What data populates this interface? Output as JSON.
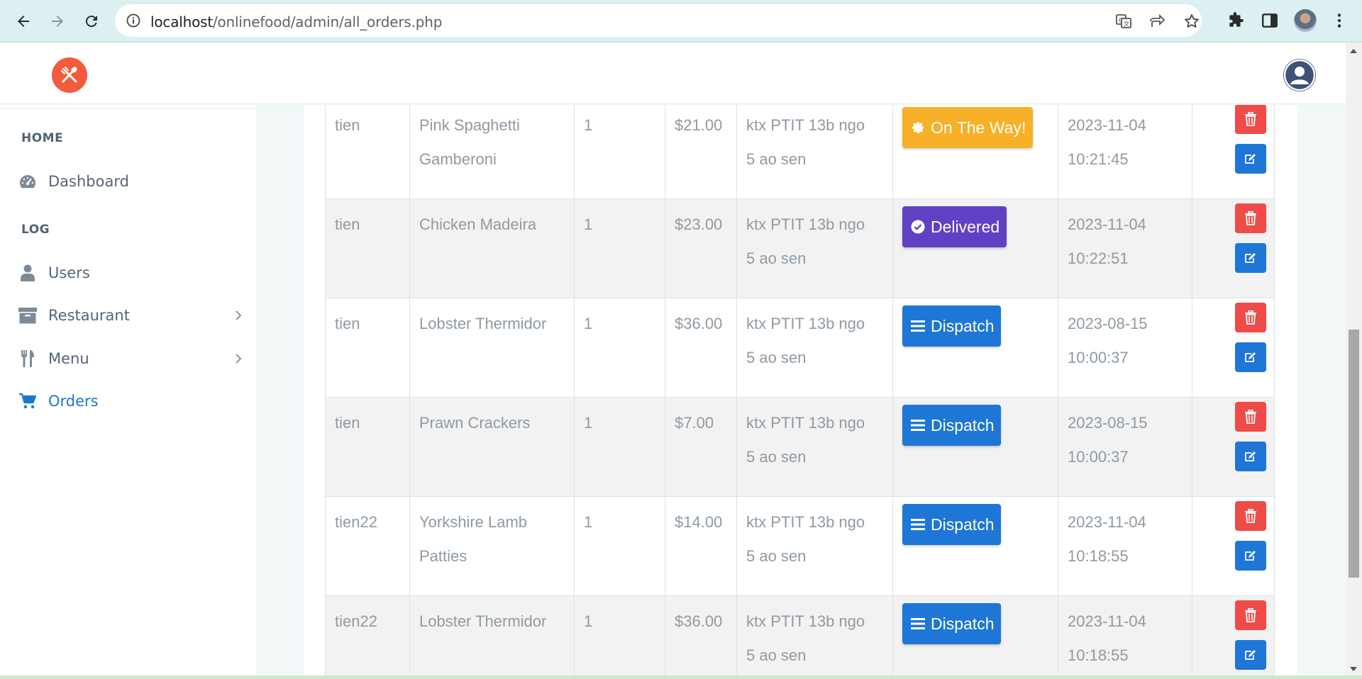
{
  "browser": {
    "url_host": "localhost",
    "url_path": "/onlinefood/admin/all_orders.php"
  },
  "sidebar": {
    "home_caption": "HOME",
    "log_caption": "LOG",
    "items": [
      {
        "label": "Dashboard"
      },
      {
        "label": "Users"
      },
      {
        "label": "Restaurant"
      },
      {
        "label": "Menu"
      },
      {
        "label": "Orders"
      }
    ]
  },
  "orders": [
    {
      "user": "tien",
      "title_line1": "Pink Spaghetti",
      "title_line2": "Gamberoni",
      "quantity": "1",
      "price": "$21.00",
      "address_line1": "ktx PTIT 13b ngo",
      "address_line2": "5 ao sen",
      "status": "On The Way!",
      "date": "2023-11-04",
      "time": "10:21:45"
    },
    {
      "user": "tien",
      "title_line1": "Chicken Madeira",
      "title_line2": "",
      "quantity": "1",
      "price": "$23.00",
      "address_line1": "ktx PTIT 13b ngo",
      "address_line2": "5 ao sen",
      "status": "Delivered",
      "date": "2023-11-04",
      "time": "10:22:51"
    },
    {
      "user": "tien",
      "title_line1": "Lobster Thermidor",
      "title_line2": "",
      "quantity": "1",
      "price": "$36.00",
      "address_line1": "ktx PTIT 13b ngo",
      "address_line2": "5 ao sen",
      "status": "Dispatch",
      "date": "2023-08-15",
      "time": "10:00:37"
    },
    {
      "user": "tien",
      "title_line1": "Prawn Crackers",
      "title_line2": "",
      "quantity": "1",
      "price": "$7.00",
      "address_line1": "ktx PTIT 13b ngo",
      "address_line2": "5 ao sen",
      "status": "Dispatch",
      "date": "2023-08-15",
      "time": "10:00:37"
    },
    {
      "user": "tien22",
      "title_line1": "Yorkshire Lamb",
      "title_line2": "Patties",
      "quantity": "1",
      "price": "$14.00",
      "address_line1": "ktx PTIT 13b ngo",
      "address_line2": "5 ao sen",
      "status": "Dispatch",
      "date": "2023-11-04",
      "time": "10:18:55"
    },
    {
      "user": "tien22",
      "title_line1": "Lobster Thermidor",
      "title_line2": "",
      "quantity": "1",
      "price": "$36.00",
      "address_line1": "ktx PTIT 13b ngo",
      "address_line2": "5 ao sen",
      "status": "Dispatch",
      "date": "2023-11-04",
      "time": "10:18:55"
    }
  ],
  "colors": {
    "dispatch": "#1e76d6",
    "delivered": "#6041c4",
    "on_the_way": "#f7b027",
    "delete": "#ef4b49",
    "edit": "#1e76d6",
    "brand": "#f25c3c",
    "active_nav": "#1976d2"
  },
  "icons": {
    "status_on_the_way": "gear-icon",
    "status_delivered": "check-circle-icon",
    "status_dispatch": "bars-icon",
    "delete": "trash-icon",
    "edit": "edit-icon"
  }
}
